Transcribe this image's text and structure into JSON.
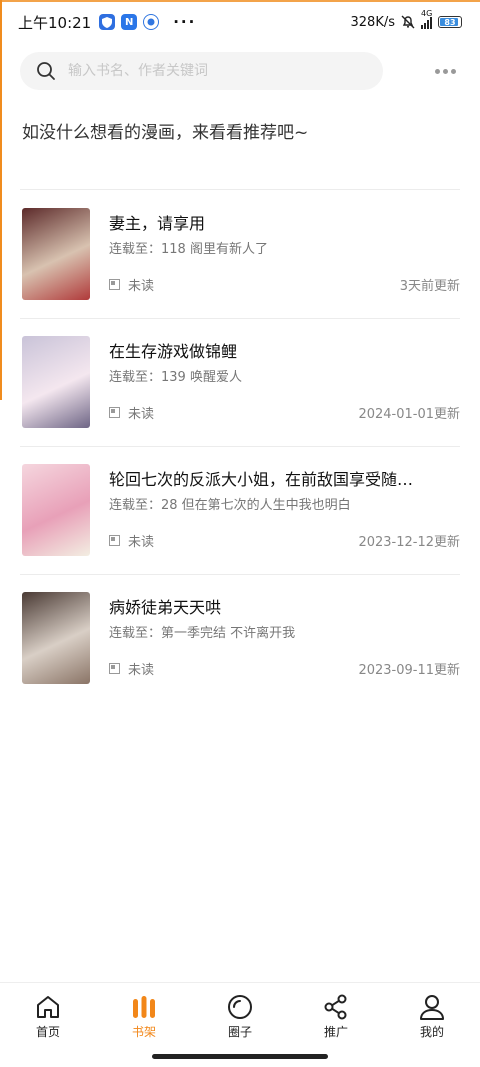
{
  "status": {
    "time": "上午10:21",
    "apps": [
      {
        "letter": "",
        "color": "#2f6fe0"
      },
      {
        "letter": "N",
        "color": "#2a76e8"
      },
      {
        "letter": "",
        "color": "#3076e0"
      }
    ],
    "more": "···",
    "speed": "328K/s",
    "net": "4G",
    "battery": "83",
    "battery_level": 0.83
  },
  "search": {
    "placeholder": "输入书名、作者关键词"
  },
  "tip": "如没什么想看的漫画，来看看推荐吧~",
  "shelf": [
    {
      "title": "妻主，请享用",
      "progress": "连载至：118 阁里有新人了",
      "read": "未读",
      "updated": "3天前更新",
      "cover": [
        "#5c2a2a",
        "#d8c2b0",
        "#b03a3a"
      ]
    },
    {
      "title": "在生存游戏做锦鲤",
      "progress": "连载至：139 唤醒爱人",
      "read": "未读",
      "updated": "2024-01-01更新",
      "cover": [
        "#c9c3d8",
        "#f4e7ef",
        "#6e6585"
      ]
    },
    {
      "title": "轮回七次的反派大小姐，在前敌国享受随…",
      "progress": "连载至：28 但在第七次的人生中我也明白",
      "read": "未读",
      "updated": "2023-12-12更新",
      "cover": [
        "#f5d6de",
        "#e8a0b8",
        "#f3eee2"
      ]
    },
    {
      "title": "病娇徒弟天天哄",
      "progress": "连载至：第一季完结 不许离开我",
      "read": "未读",
      "updated": "2023-09-11更新",
      "cover": [
        "#4a3a34",
        "#d9cfc6",
        "#8a7466"
      ]
    }
  ],
  "tabs": [
    {
      "label": "首页",
      "icon": "home-icon"
    },
    {
      "label": "书架",
      "icon": "bookshelf-icon"
    },
    {
      "label": "圈子",
      "icon": "circle-icon"
    },
    {
      "label": "推广",
      "icon": "share-icon"
    },
    {
      "label": "我的",
      "icon": "user-icon"
    }
  ],
  "active_tab": 1,
  "accent": "#f28719"
}
